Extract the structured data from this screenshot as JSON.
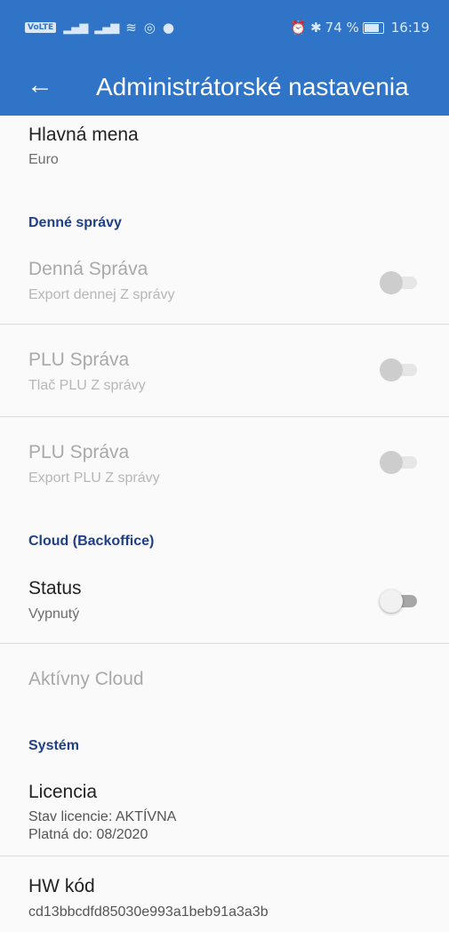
{
  "status_bar": {
    "left_badge": "VoLTE",
    "right_text": "74 %",
    "time": "16:19",
    "icons": [
      "signal-icon",
      "wifi-icon",
      "alarm-icon",
      "bluetooth-icon",
      "battery-icon"
    ]
  },
  "app_bar": {
    "back_icon": "arrow-left-icon",
    "title": "Administrátorské nastavenia"
  },
  "items": {
    "main_currency": {
      "title": "Hlavná mena",
      "value": "Euro"
    },
    "section_daily": "Denné správy",
    "daily_report": {
      "title": "Denná Správa",
      "subtitle": "Export dennej Z správy",
      "enabled": false
    },
    "plu_print": {
      "title": "PLU Správa",
      "subtitle": "Tlač PLU Z správy",
      "enabled": false
    },
    "plu_export": {
      "title": "PLU Správa",
      "subtitle": "Export PLU Z správy",
      "enabled": false
    },
    "section_cloud": "Cloud (Backoffice)",
    "cloud_status": {
      "title": "Status",
      "subtitle": "Vypnutý",
      "enabled": false
    },
    "active_cloud": {
      "title": "Aktívny Cloud"
    },
    "section_system": "Systém",
    "license": {
      "title": "Licencia",
      "line1": "Stav licencie: AKTÍVNA",
      "line2": "Platná do: 08/2020"
    },
    "hw_code": {
      "title": "HW kód",
      "value": "cd13bbcdfd85030e993a1beb91a3a3b"
    }
  },
  "colors": {
    "primary": "#2f74c6",
    "section_header": "#1f3f86"
  }
}
